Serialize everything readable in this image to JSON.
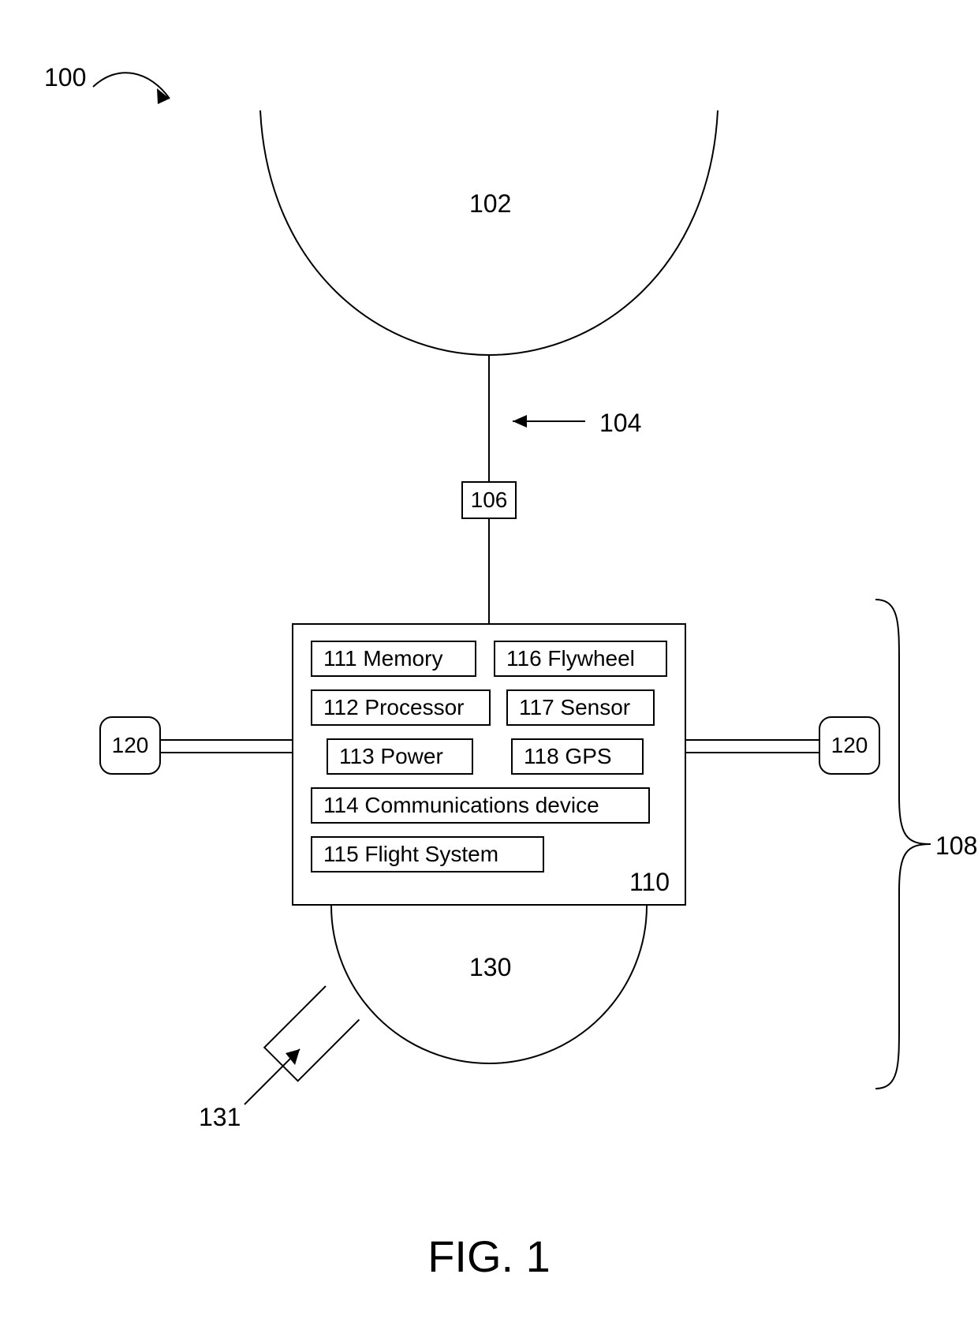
{
  "refs": {
    "r100": "100",
    "r102": "102",
    "r104": "104",
    "r106": "106",
    "r108": "108",
    "r110": "110",
    "r120L": "120",
    "r120R": "120",
    "r130": "130",
    "r131": "131"
  },
  "components": {
    "c111": "111 Memory",
    "c112": "112 Processor",
    "c113": "113 Power",
    "c114": "114 Communications device",
    "c115": "115 Flight System",
    "c116": "116 Flywheel",
    "c117": "117 Sensor",
    "c118": "118 GPS"
  },
  "figure_caption": "FIG. 1"
}
